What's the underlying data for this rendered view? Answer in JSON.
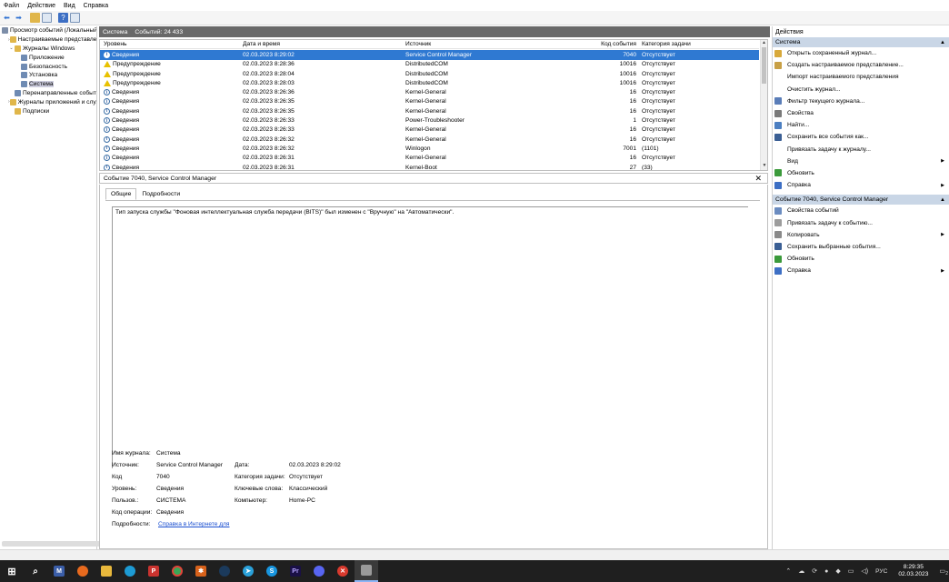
{
  "menu": [
    "Файл",
    "Действие",
    "Вид",
    "Справка"
  ],
  "tree": [
    {
      "label": "Просмотр событий (Локальный)",
      "indent": 0,
      "exp": ""
    },
    {
      "label": "Настраиваемые представления",
      "indent": 1,
      "exp": "›"
    },
    {
      "label": "Журналы Windows",
      "indent": 1,
      "exp": "⌄"
    },
    {
      "label": "Приложение",
      "indent": 2,
      "exp": ""
    },
    {
      "label": "Безопасность",
      "indent": 2,
      "exp": ""
    },
    {
      "label": "Установка",
      "indent": 2,
      "exp": ""
    },
    {
      "label": "Система",
      "indent": 2,
      "exp": "",
      "selected": true
    },
    {
      "label": "Перенаправленные события",
      "indent": 2,
      "exp": ""
    },
    {
      "label": "Журналы приложений и служб",
      "indent": 1,
      "exp": "›"
    },
    {
      "label": "Подписки",
      "indent": 1,
      "exp": ""
    }
  ],
  "center": {
    "log_name": "Система",
    "event_count": "Событий: 24 433"
  },
  "table": {
    "headers": {
      "level": "Уровень",
      "date": "Дата и время",
      "source": "Источник",
      "code": "Код события",
      "category": "Категория задачи"
    },
    "rows": [
      {
        "level": "Сведения",
        "type": "info",
        "date": "02.03.2023 8:29:02",
        "source": "Service Control Manager",
        "code": "7040",
        "category": "Отсутствует",
        "selected": true
      },
      {
        "level": "Предупреждение",
        "type": "warn",
        "date": "02.03.2023 8:28:36",
        "source": "DistributedCOM",
        "code": "10016",
        "category": "Отсутствует"
      },
      {
        "level": "Предупреждение",
        "type": "warn",
        "date": "02.03.2023 8:28:04",
        "source": "DistributedCOM",
        "code": "10016",
        "category": "Отсутствует"
      },
      {
        "level": "Предупреждение",
        "type": "warn",
        "date": "02.03.2023 8:28:03",
        "source": "DistributedCOM",
        "code": "10016",
        "category": "Отсутствует"
      },
      {
        "level": "Сведения",
        "type": "info",
        "date": "02.03.2023 8:26:36",
        "source": "Kernel-General",
        "code": "16",
        "category": "Отсутствует"
      },
      {
        "level": "Сведения",
        "type": "info",
        "date": "02.03.2023 8:26:35",
        "source": "Kernel-General",
        "code": "16",
        "category": "Отсутствует"
      },
      {
        "level": "Сведения",
        "type": "info",
        "date": "02.03.2023 8:26:35",
        "source": "Kernel-General",
        "code": "16",
        "category": "Отсутствует"
      },
      {
        "level": "Сведения",
        "type": "info",
        "date": "02.03.2023 8:26:33",
        "source": "Power-Troubleshooter",
        "code": "1",
        "category": "Отсутствует"
      },
      {
        "level": "Сведения",
        "type": "info",
        "date": "02.03.2023 8:26:33",
        "source": "Kernel-General",
        "code": "16",
        "category": "Отсутствует"
      },
      {
        "level": "Сведения",
        "type": "info",
        "date": "02.03.2023 8:26:32",
        "source": "Kernel-General",
        "code": "16",
        "category": "Отсутствует"
      },
      {
        "level": "Сведения",
        "type": "info",
        "date": "02.03.2023 8:26:32",
        "source": "Winlogon",
        "code": "7001",
        "category": "(1101)"
      },
      {
        "level": "Сведения",
        "type": "info",
        "date": "02.03.2023 8:26:31",
        "source": "Kernel-General",
        "code": "16",
        "category": "Отсутствует"
      },
      {
        "level": "Сведения",
        "type": "info",
        "date": "02.03.2023 8:26:31",
        "source": "Kernel-Boot",
        "code": "27",
        "category": "(33)"
      }
    ]
  },
  "detail": {
    "title": "Событие 7040, Service Control Manager",
    "tabs": [
      "Общие",
      "Подробности"
    ],
    "description": "Тип запуска службы \"Фоновая интеллектуальная служба передачи (BITS)\" был изменен с \"Вручную\" на \"Автоматически\".",
    "props": {
      "log_label": "Имя журнала:",
      "log_value": "Система",
      "source_label": "Источник:",
      "source_value": "Service Control Manager",
      "date_label": "Дата:",
      "date_value": "02.03.2023 8:29:02",
      "code_label": "Код",
      "code_value": "7040",
      "category_label": "Категория задачи:",
      "category_value": "Отсутствует",
      "level_label": "Уровень:",
      "level_value": "Сведения",
      "keywords_label": "Ключевые слова:",
      "keywords_value": "Классический",
      "user_label": "Пользов.:",
      "user_value": "СИСТЕМА",
      "computer_label": "Компьютер:",
      "computer_value": "Home-PC",
      "opcode_label": "Код операции:",
      "opcode_value": "Сведения",
      "more_label": "Подробности:",
      "more_link": "Справка в Интернете для"
    }
  },
  "actions": {
    "title": "Действия",
    "section1": "Система",
    "items1": [
      {
        "label": "Открыть сохраненный журнал...",
        "icon": "folder-icon",
        "color": "#d8a93b"
      },
      {
        "label": "Создать настраиваемое представление...",
        "icon": "filter-create-icon",
        "color": "#c8a046"
      },
      {
        "label": "Импорт настраиваемого представления",
        "icon": "",
        "color": ""
      },
      {
        "label": "Очистить журнал...",
        "icon": "",
        "color": ""
      },
      {
        "label": "Фильтр текущего журнала...",
        "icon": "filter-icon",
        "color": "#5a7db8"
      },
      {
        "label": "Свойства",
        "icon": "properties-icon",
        "color": "#7a7a7a"
      },
      {
        "label": "Найти...",
        "icon": "find-icon",
        "color": "#4c7fc1"
      },
      {
        "label": "Сохранить все события как...",
        "icon": "save-icon",
        "color": "#3b5f94"
      },
      {
        "label": "Привязать задачу к журналу...",
        "icon": "",
        "color": ""
      },
      {
        "label": "Вид",
        "icon": "",
        "color": "",
        "sub": true
      },
      {
        "label": "Обновить",
        "icon": "refresh-icon",
        "color": "#3b9a3b"
      },
      {
        "label": "Справка",
        "icon": "help-icon",
        "color": "#3d6fc4",
        "sub": true
      }
    ],
    "section2": "Событие 7040, Service Control Manager",
    "items2": [
      {
        "label": "Свойства событий",
        "icon": "event-properties-icon",
        "color": "#6b8cc0"
      },
      {
        "label": "Привязать задачу к событию...",
        "icon": "task-icon",
        "color": "#9c9c9c"
      },
      {
        "label": "Копировать",
        "icon": "copy-icon",
        "color": "#8a8a8a",
        "sub": true
      },
      {
        "label": "Сохранить выбранные события...",
        "icon": "save-icon",
        "color": "#3b5f94"
      },
      {
        "label": "Обновить",
        "icon": "refresh-icon",
        "color": "#3b9a3b"
      },
      {
        "label": "Справка",
        "icon": "help-icon",
        "color": "#3d6fc4",
        "sub": true
      }
    ]
  },
  "taskbar": {
    "lang": "РУС",
    "time": "8:29:35",
    "date": "02.03.2023",
    "notif": "2"
  }
}
